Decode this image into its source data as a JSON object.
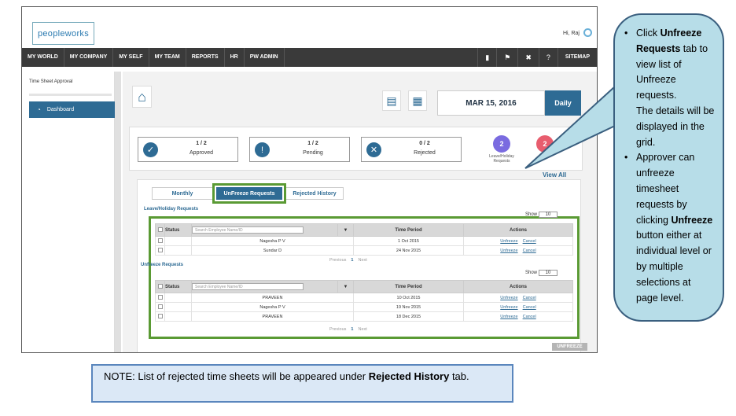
{
  "header": {
    "logo_text": "peopleworks",
    "greeting": "Hi, Raj"
  },
  "nav": {
    "items": [
      "MY WORLD",
      "MY COMPANY",
      "MY SELF",
      "MY TEAM",
      "REPORTS",
      "HR",
      "PW ADMIN"
    ],
    "sitemap": "SITEMAP"
  },
  "sidebar": {
    "title": "Time Sheet Approval",
    "dashboard": "Dashboard"
  },
  "toolbar": {
    "date": "MAR 15, 2016",
    "view": "Daily"
  },
  "stats": [
    {
      "count": "1 / 2",
      "label": "Approved"
    },
    {
      "count": "1 / 2",
      "label": "Pending"
    },
    {
      "count": "0 / 2",
      "label": "Rejected"
    }
  ],
  "bubbles": [
    {
      "count": "2",
      "label": "Leave/Holiday Requests",
      "color": "#7a6be0"
    },
    {
      "count": "2",
      "label": "",
      "color": "#e85d6e"
    }
  ],
  "view_all": "View All",
  "tabs": [
    "Monthly",
    "UnFreeze Requests",
    "Rejected History"
  ],
  "leave_section": {
    "title": "Leave/Holiday Requests",
    "show_label": "Show",
    "show_value": "10",
    "columns": [
      "Status",
      "Time Period",
      "Actions"
    ],
    "search_placeholder": "Search Employee Name/ID",
    "rows": [
      {
        "name": "Nagesha P V",
        "period": "1 Oct 2015"
      },
      {
        "name": "Sundar D",
        "period": "24 Nov 2015"
      }
    ],
    "pager": {
      "prev": "Previous",
      "page": "1",
      "next": "Next"
    }
  },
  "unfreeze_section": {
    "title": "Unfreeze Requests",
    "show_label": "Show",
    "show_value": "10",
    "columns": [
      "Status",
      "Time Period",
      "Actions"
    ],
    "search_placeholder": "Search Employee Name/ID",
    "rows": [
      {
        "name": "PRAVEEN",
        "period": "10 Oct 2015"
      },
      {
        "name": "Nagesha P V",
        "period": "19 Nov 2015"
      },
      {
        "name": "PRAVEEN",
        "period": "18 Dec 2015"
      }
    ],
    "pager": {
      "prev": "Previous",
      "page": "1",
      "next": "Next"
    }
  },
  "actions": {
    "unfreeze": "Unfreeze",
    "cancel": "Cancel"
  },
  "unfreeze_button": "UNFREEZE",
  "callout": {
    "bullet1_pre": "Click ",
    "bullet1_bold": "Unfreeze Requests",
    "bullet1_post": " tab to view list of Unfreeze requests.",
    "bullet1_line2": "The details will be displayed in the grid.",
    "bullet2_pre": "Approver can unfreeze timesheet requests by clicking ",
    "bullet2_bold": "Unfreeze",
    "bullet2_post": " button either at individual level or by multiple selections at page level."
  },
  "note": {
    "pre": "NOTE: List of rejected time sheets will be appeared under ",
    "bold": "Rejected History",
    "post": " tab."
  }
}
